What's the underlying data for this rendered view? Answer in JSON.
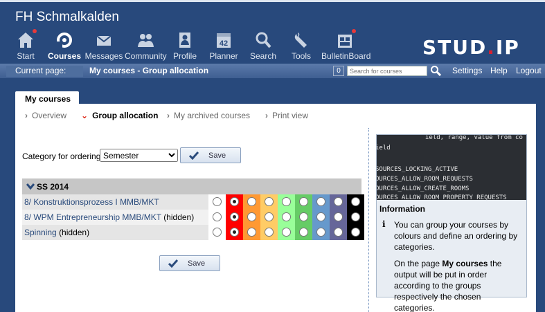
{
  "header": {
    "site_title": "FH Schmalkalden",
    "logo_main": "STUD",
    "logo_dot": ".",
    "logo_end": "IP",
    "nav": [
      {
        "label": "Start",
        "icon": "house-icon",
        "badge": true
      },
      {
        "label": "Courses",
        "icon": "courses-icon",
        "active": true
      },
      {
        "label": "Messages",
        "icon": "envelope-icon"
      },
      {
        "label": "Community",
        "icon": "people-icon"
      },
      {
        "label": "Profile",
        "icon": "profile-icon"
      },
      {
        "label": "Planner",
        "icon": "calendar-icon",
        "day": "42"
      },
      {
        "label": "Search",
        "icon": "magnifier-icon"
      },
      {
        "label": "Tools",
        "icon": "wrench-icon"
      },
      {
        "label": "BulletinBoard",
        "icon": "bulletin-icon",
        "badge": true
      }
    ]
  },
  "bar": {
    "current_label": "Current page:",
    "current_value": "My courses - Group allocation",
    "count": "0",
    "search_placeholder": "Search for courses",
    "settings": "Settings",
    "help": "Help",
    "logout": "Logout"
  },
  "tab": {
    "label": "My courses"
  },
  "subnav": [
    {
      "label": "Overview"
    },
    {
      "label": "Group allocation",
      "active": true
    },
    {
      "label": "My archived courses"
    },
    {
      "label": "Print view"
    }
  ],
  "ordering": {
    "label": "Category for ordering:",
    "selected": "Semester",
    "save": "Save"
  },
  "semester": {
    "label": "SS 2014"
  },
  "group_colors": [
    "#ffffff",
    "#ff0000",
    "#ff9933",
    "#ffcc66",
    "#99ff99",
    "#66cc66",
    "#6699cc",
    "#666699",
    "#000000"
  ],
  "courses": [
    {
      "name": "8/ Konstruktionsprozess I MMB/MKT",
      "suffix": "",
      "selected": 1
    },
    {
      "name": "8/ WPM Entrepreneurship MMB/MKT",
      "suffix": "(hidden)",
      "selected": 1
    },
    {
      "name": "Spinning",
      "suffix": "(hidden)",
      "selected": 1
    }
  ],
  "bottom_save": "Save",
  "info": {
    "image_lines": [
      "ield, range, value from co",
      "ield",
      "SOURCES_LOCKING_ACTIVE",
      "OURCES_ALLOW_ROOM_REQUESTS",
      "OURCES_ALLOW_CREATE_ROOMS",
      "OURCES_ALLOW_ROOM_PROPERTY_REQUESTS"
    ],
    "title": "Information",
    "p1": "You can group your courses by colours and define an ordering by categories.",
    "p2_pre": "On the page ",
    "p2_bold": "My courses",
    "p2_post": " the output will be put in order according to the groups respectively the chosen categories."
  }
}
